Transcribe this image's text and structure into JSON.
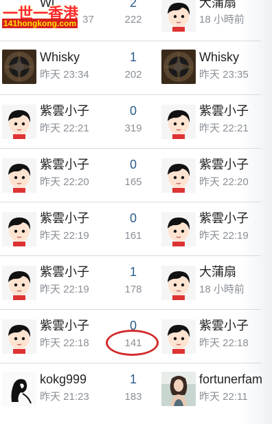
{
  "logo": {
    "main_text": "一世一香港",
    "sub_text": "141hongkong.com"
  },
  "rows": [
    {
      "left_name": "Wi",
      "left_time": "37",
      "replies": "2",
      "views": "222",
      "right_name": "大蒲扇",
      "right_time": "18 小時前"
    },
    {
      "left_name": "Whisky",
      "left_time": "昨天 23:34",
      "replies": "1",
      "views": "202",
      "right_name": "Whisky",
      "right_time": "昨天 23:35"
    },
    {
      "left_name": "紫雲小子",
      "left_time": "昨天 22:21",
      "replies": "0",
      "views": "319",
      "right_name": "紫雲小子",
      "right_time": "昨天 22:21"
    },
    {
      "left_name": "紫雲小子",
      "left_time": "昨天 22:20",
      "replies": "0",
      "views": "165",
      "right_name": "紫雲小子",
      "right_time": "昨天 22:20"
    },
    {
      "left_name": "紫雲小子",
      "left_time": "昨天 22:19",
      "replies": "0",
      "views": "161",
      "right_name": "紫雲小子",
      "right_time": "昨天 22:19"
    },
    {
      "left_name": "紫雲小子",
      "left_time": "昨天 22:19",
      "replies": "1",
      "views": "178",
      "right_name": "大蒲扇",
      "right_time": "18 小時前"
    },
    {
      "left_name": "紫雲小子",
      "left_time": "昨天 22:18",
      "replies": "0",
      "views": "141",
      "right_name": "紫雲小子",
      "right_time": "昨天 22:18"
    },
    {
      "left_name": "kokg999",
      "left_time": "昨天 21:23",
      "replies": "1",
      "views": "183",
      "right_name": "fortunerfam",
      "right_time": "昨天 22:11"
    }
  ],
  "colors": {
    "reply_count": "#2a5c8a",
    "muted_text": "#8a8f96",
    "highlight_oval": "#d22b2b",
    "logo_red": "#ff2a2a",
    "logo_yellow": "#ffe000"
  },
  "icons": {
    "avatar_whisky": "dark-flower-avatar",
    "avatar_cartoon": "cartoon-boy-avatar",
    "avatar_kokg": "sketch-person-avatar",
    "avatar_fortuner": "woman-photo-avatar",
    "annotation": "red-circle-highlight"
  }
}
